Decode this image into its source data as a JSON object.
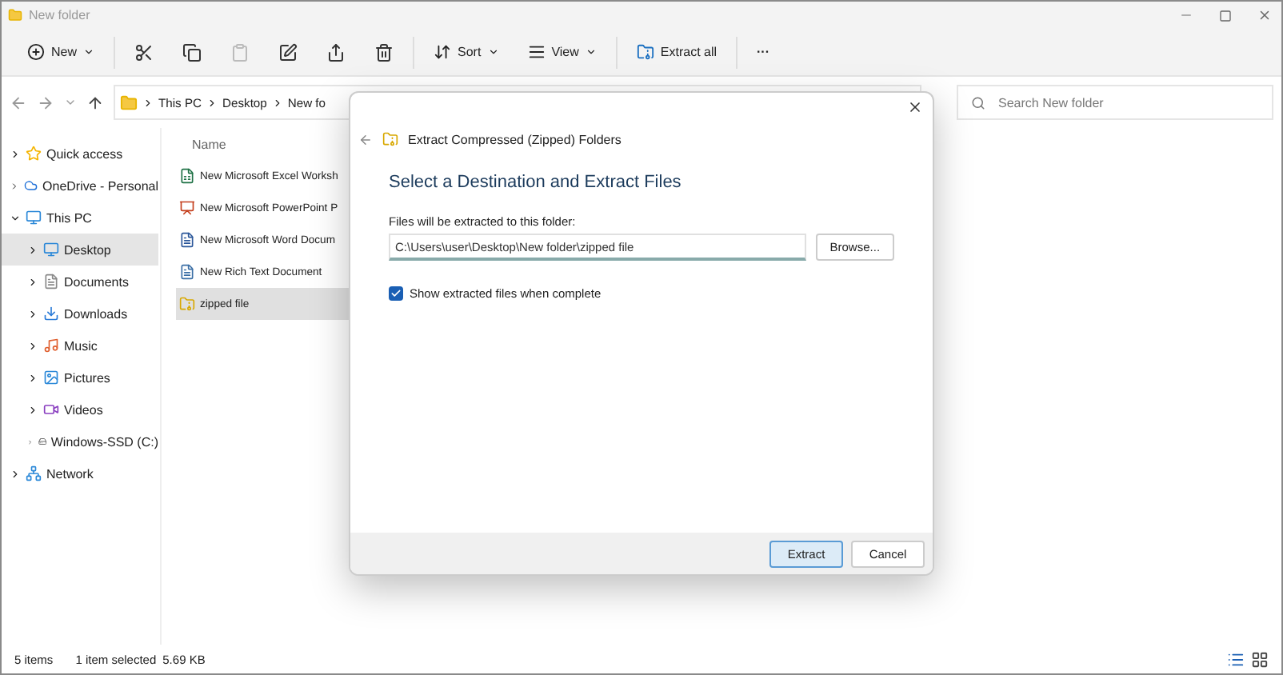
{
  "window": {
    "title": "New folder"
  },
  "toolbar": {
    "new": "New",
    "sort": "Sort",
    "view": "View",
    "extract_all": "Extract all",
    "more": "···"
  },
  "breadcrumb": [
    "This PC",
    "Desktop",
    "New fo"
  ],
  "search": {
    "placeholder": "Search New folder"
  },
  "sidebar": {
    "items": [
      {
        "label": "Quick access",
        "expanded": false,
        "selected": false
      },
      {
        "label": "OneDrive - Personal",
        "expanded": false,
        "selected": false
      },
      {
        "label": "This PC",
        "expanded": true,
        "selected": false,
        "children": [
          {
            "label": "Desktop",
            "expanded": false,
            "selected": true
          },
          {
            "label": "Documents",
            "expanded": false,
            "selected": false
          },
          {
            "label": "Downloads",
            "expanded": false,
            "selected": false
          },
          {
            "label": "Music",
            "expanded": false,
            "selected": false
          },
          {
            "label": "Pictures",
            "expanded": false,
            "selected": false
          },
          {
            "label": "Videos",
            "expanded": false,
            "selected": false
          },
          {
            "label": "Windows-SSD (C:)",
            "expanded": false,
            "selected": false
          }
        ]
      },
      {
        "label": "Network",
        "expanded": false,
        "selected": false
      }
    ]
  },
  "files": {
    "column": "Name",
    "rows": [
      {
        "name": "New Microsoft Excel Worksh",
        "kind": "excel",
        "selected": false
      },
      {
        "name": "New Microsoft PowerPoint P",
        "kind": "powerpoint",
        "selected": false
      },
      {
        "name": "New Microsoft Word Docum",
        "kind": "word",
        "selected": false
      },
      {
        "name": "New Rich Text Document",
        "kind": "rtf",
        "selected": false
      },
      {
        "name": "zipped file",
        "kind": "zip",
        "selected": true
      }
    ]
  },
  "dialog": {
    "title": "Extract Compressed (Zipped) Folders",
    "heading": "Select a Destination and Extract Files",
    "field_label": "Files will be extracted to this folder:",
    "path": "C:\\Users\\user\\Desktop\\New folder\\zipped file",
    "browse": "Browse...",
    "show_files": {
      "label": "Show extracted files when complete",
      "checked": true
    },
    "buttons": [
      {
        "label": "Extract",
        "primary": true
      },
      {
        "label": "Cancel",
        "primary": false
      }
    ]
  },
  "status_bar": {
    "items": "5 items",
    "selection": "1 item selected",
    "size": "5.69 KB"
  }
}
